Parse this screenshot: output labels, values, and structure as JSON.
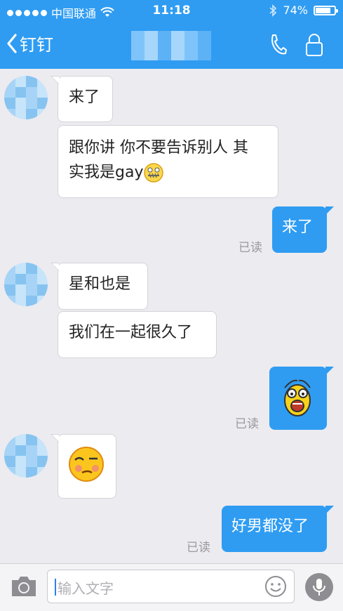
{
  "status_bar": {
    "carrier": "中国联通",
    "time": "11:18",
    "battery": "74%",
    "battery_level": 0.74
  },
  "nav": {
    "back_label": "钉钉"
  },
  "messages": {
    "m1": "来了",
    "m2_line1": "跟你讲 你不要告诉别人 其",
    "m2_line2": "实我是gay",
    "m3": "来了",
    "m4": "星和也是",
    "m5": "我们在一起很久了",
    "m8": "好男都没了",
    "read_label": "已读"
  },
  "input": {
    "placeholder": "输入文字"
  },
  "colors": {
    "accent": "#2f9cf2",
    "background": "#ecebf0",
    "read": "#9a9a9e"
  },
  "icons": [
    "chevron-left-icon",
    "phone-icon",
    "lock-icon",
    "camera-icon",
    "smile-icon",
    "mic-icon",
    "wifi-icon",
    "bluetooth-icon",
    "battery-icon"
  ]
}
